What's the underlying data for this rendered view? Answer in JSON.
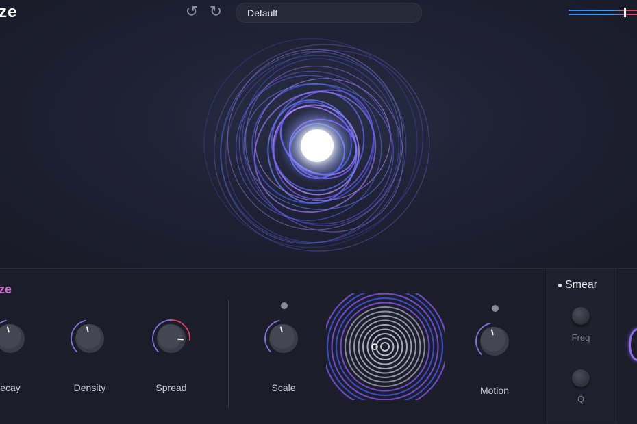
{
  "app": {
    "logo_text": "ze"
  },
  "toolbar": {
    "undo_icon": "undo-icon",
    "redo_icon": "redo-icon",
    "preset_name": "Default",
    "output_meter_level": 0.82
  },
  "panel": {
    "section_title": "ze",
    "knobs": [
      {
        "label": "ecay",
        "value": 0.45
      },
      {
        "label": "Density",
        "value": 0.45
      },
      {
        "label": "Spread",
        "value": 0.85
      }
    ],
    "scale": {
      "label": "Scale",
      "value": 0.45
    },
    "motion": {
      "label": "Motion",
      "value": 0.45
    },
    "smear": {
      "title": "Smear",
      "freq_label": "Freq",
      "q_label": "Q"
    }
  },
  "colors": {
    "accent_pink": "#d36ed6",
    "arc_red": "#e0455b",
    "arc_purple": "#8d6ee6",
    "meter_blue": "#2f86ff"
  }
}
